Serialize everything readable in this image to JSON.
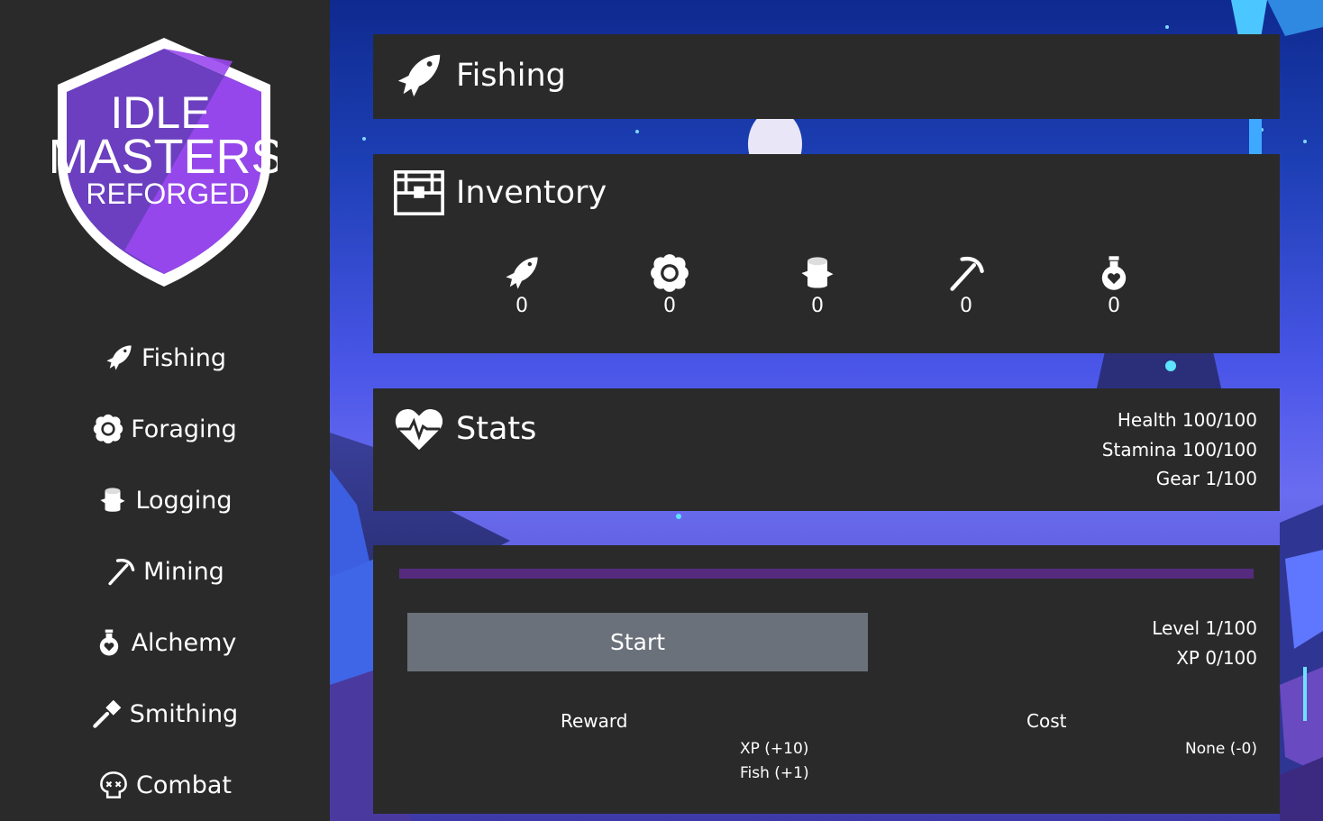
{
  "logo": {
    "line1": "IDLE",
    "line2": "MASTERS",
    "line3": "REFORGED"
  },
  "sidebar": {
    "items": [
      {
        "label": "Fishing",
        "icon": "fish-icon"
      },
      {
        "label": "Foraging",
        "icon": "flower-icon"
      },
      {
        "label": "Logging",
        "icon": "log-icon"
      },
      {
        "label": "Mining",
        "icon": "pickaxe-icon"
      },
      {
        "label": "Alchemy",
        "icon": "potion-icon"
      },
      {
        "label": "Smithing",
        "icon": "hammer-icon"
      },
      {
        "label": "Combat",
        "icon": "skull-icon"
      }
    ]
  },
  "activity": {
    "title": "Fishing",
    "icon": "fish-icon"
  },
  "inventory": {
    "title": "Inventory",
    "icon": "treasure-chest-icon",
    "slots": [
      {
        "icon": "fish-icon",
        "count": "0"
      },
      {
        "icon": "flower-icon",
        "count": "0"
      },
      {
        "icon": "log-icon",
        "count": "0"
      },
      {
        "icon": "pickaxe-icon",
        "count": "0"
      },
      {
        "icon": "potion-icon",
        "count": "0"
      }
    ]
  },
  "stats": {
    "title": "Stats",
    "icon": "heart-pulse-icon",
    "health": "Health 100/100",
    "stamina": "Stamina 100/100",
    "gear": "Gear 1/100"
  },
  "action": {
    "xp_progress": 0,
    "start_label": "Start",
    "level": "Level 1/100",
    "xp": "XP 0/100",
    "reward_header": "Reward",
    "rewards": [
      "XP (+10)",
      "Fish (+1)"
    ],
    "cost_header": "Cost",
    "costs": [
      "None (-0)"
    ]
  },
  "colors": {
    "panel": "#2a2a2a",
    "sidebar": "#2a2a2a",
    "accent_purple": "#562b7e",
    "button": "#6b717a",
    "logo_purple": "#8a3fd8"
  }
}
